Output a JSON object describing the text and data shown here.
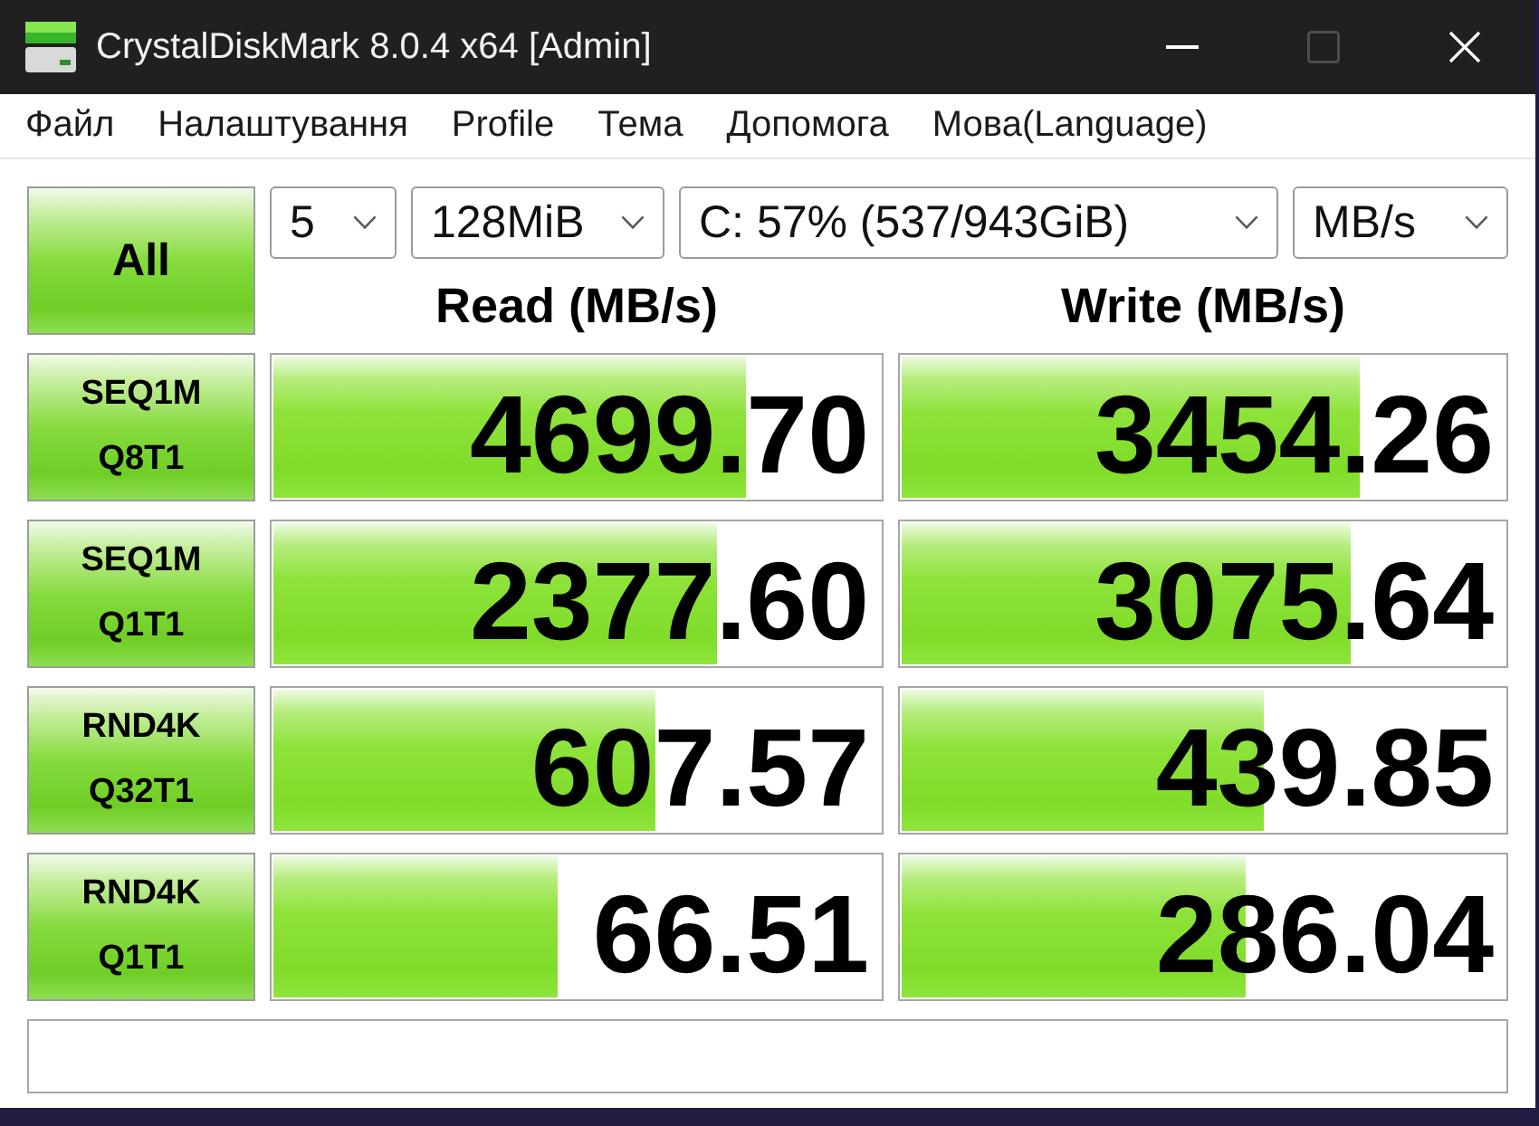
{
  "window": {
    "title": "CrystalDiskMark 8.0.4 x64 [Admin]",
    "controls": [
      {
        "kind": "minimize",
        "disabled": false
      },
      {
        "kind": "maximize",
        "disabled": true
      },
      {
        "kind": "close",
        "disabled": false
      }
    ]
  },
  "menu": [
    "Файл",
    "Налаштування",
    "Profile",
    "Тема",
    "Допомога",
    "Мова(Language)"
  ],
  "toolbar": {
    "all_button": "All",
    "selects": [
      {
        "value": "5"
      },
      {
        "value": "128MiB"
      },
      {
        "value": "C: 57% (537/943GiB)"
      },
      {
        "value": "MB/s"
      }
    ]
  },
  "columns": [
    "Read (MB/s)",
    "Write (MB/s)"
  ],
  "tests": [
    {
      "name": "SEQ1M",
      "params": "Q8T1",
      "read": {
        "value": "4699.70",
        "level": 0.78
      },
      "write": {
        "value": "3454.26",
        "level": 0.76
      }
    },
    {
      "name": "SEQ1M",
      "params": "Q1T1",
      "read": {
        "value": "2377.60",
        "level": 0.73
      },
      "write": {
        "value": "3075.64",
        "level": 0.745
      }
    },
    {
      "name": "RND4K",
      "params": "Q32T1",
      "read": {
        "value": "607.57",
        "level": 0.63
      },
      "write": {
        "value": "439.85",
        "level": 0.6
      }
    },
    {
      "name": "RND4K",
      "params": "Q1T1",
      "read": {
        "value": "66.51",
        "level": 0.47
      },
      "write": {
        "value": "286.04",
        "level": 0.57
      }
    }
  ]
}
